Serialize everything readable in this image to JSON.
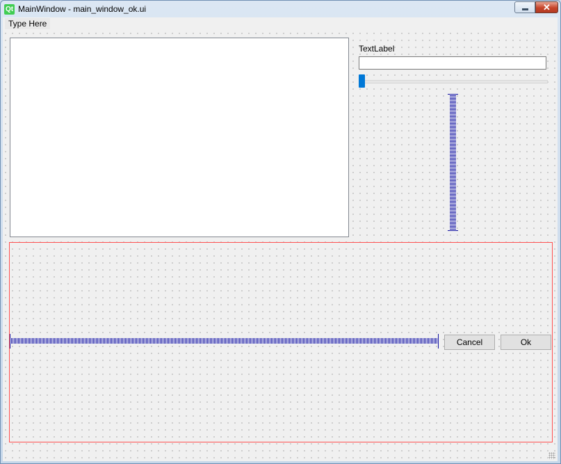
{
  "window": {
    "title": "MainWindow - main_window_ok.ui",
    "logo_text": "Qt"
  },
  "title_controls": {
    "minimize_icon": "minimize-icon",
    "close_icon": "close-icon",
    "close_glyph": "✕"
  },
  "menubar": {
    "item": "Type Here"
  },
  "form": {
    "text_label": "TextLabel",
    "line_edit_value": "",
    "slider_value": 0
  },
  "buttons": {
    "cancel": "Cancel",
    "ok": "Ok"
  },
  "colors": {
    "layout_border": "#ff4f4f",
    "spacer": "#1010a0",
    "slider_handle": "#0078d7"
  }
}
